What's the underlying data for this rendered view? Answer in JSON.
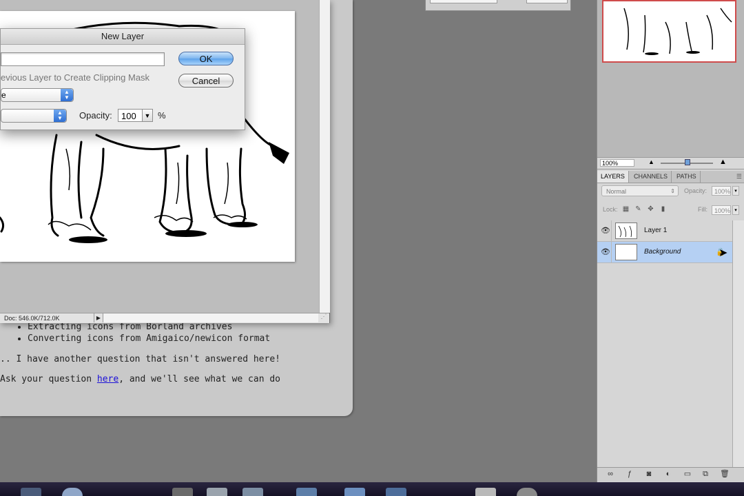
{
  "browser": {
    "bullets": [
      "Extracting icons from Borland archives",
      "Converting icons from Amigaico/newicon format"
    ],
    "question_line": "I have another question that isn't answered here!",
    "ask_prefix": "Ask your question ",
    "ask_link": "here",
    "ask_suffix": ", and we'll see what we can do"
  },
  "document": {
    "status_text": "Doc: 546.0K/712.0K"
  },
  "dialog": {
    "title": "New Layer",
    "name_value": "",
    "clip_label": "evious Layer to Create Clipping Mask",
    "mode_value": "e",
    "color_value": "",
    "opacity_label": "Opacity:",
    "opacity_value": "100",
    "opacity_unit": "%",
    "ok_label": "OK",
    "cancel_label": "Cancel"
  },
  "navigator": {
    "zoom": "100%"
  },
  "layers_panel": {
    "tabs": [
      "LAYERS",
      "CHANNELS",
      "PATHS"
    ],
    "active_tab": "LAYERS",
    "blend_mode": "Normal",
    "opacity_label": "Opacity:",
    "opacity_value": "100%",
    "lock_label": "Lock:",
    "fill_label": "Fill:",
    "fill_value": "100%",
    "layers": [
      {
        "name": "Layer 1",
        "visible": true,
        "selected": false
      },
      {
        "name": "Background",
        "visible": true,
        "selected": true,
        "locked": true
      }
    ]
  },
  "colors": {
    "accent": "#2f6fd3",
    "selection": "#b5d0f3",
    "nav_frame": "#cf4b4b"
  }
}
